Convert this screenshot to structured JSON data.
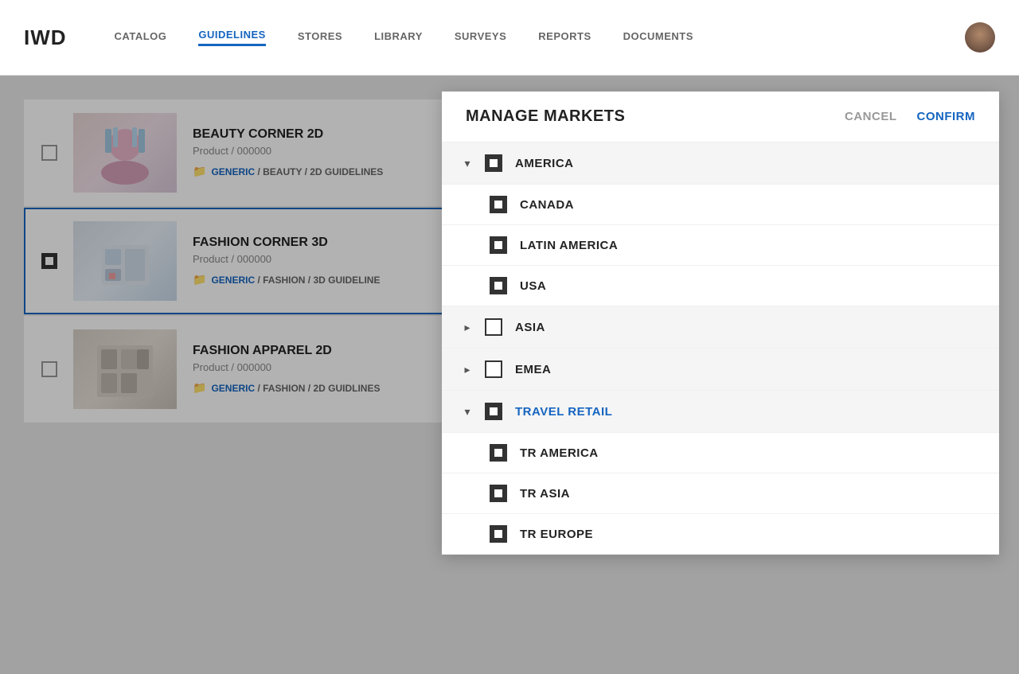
{
  "app": {
    "logo": "IWD",
    "nav": {
      "links": [
        {
          "label": "CATALOG",
          "active": false
        },
        {
          "label": "GUIDELINES",
          "active": true
        },
        {
          "label": "STORES",
          "active": false
        },
        {
          "label": "LIBRARY",
          "active": false
        },
        {
          "label": "SURVEYS",
          "active": false
        },
        {
          "label": "REPORTS",
          "active": false
        },
        {
          "label": "DOCUMENTS",
          "active": false
        }
      ]
    }
  },
  "products": [
    {
      "name": "BEAUTY CORNER 2D",
      "type": "Product",
      "id": "000000",
      "path": "GENERIC / BEAUTY / 2D GUIDELINES",
      "selected": false,
      "checked": false
    },
    {
      "name": "FASHION CORNER 3D",
      "type": "Product",
      "id": "000000",
      "path": "GENERIC / FASHION / 3D GUIDELINE",
      "selected": true,
      "checked": true
    },
    {
      "name": "FASHION APPAREL 2D",
      "type": "Product",
      "id": "000000",
      "path": "GENERIC / FASHION / 2D GUIDLINES",
      "selected": false,
      "checked": false
    }
  ],
  "modal": {
    "title": "MANAGE MARKETS",
    "cancel_label": "CANCEL",
    "confirm_label": "CONFIRM",
    "markets": [
      {
        "id": "america",
        "label": "AMERICA",
        "expanded": true,
        "checked": true,
        "active": false,
        "children": [
          {
            "id": "canada",
            "label": "CANADA",
            "checked": true
          },
          {
            "id": "latin-america",
            "label": "LATIN AMERICA",
            "checked": true
          },
          {
            "id": "usa",
            "label": "USA",
            "checked": true
          }
        ]
      },
      {
        "id": "asia",
        "label": "ASIA",
        "expanded": false,
        "checked": false,
        "active": false,
        "children": []
      },
      {
        "id": "emea",
        "label": "EMEA",
        "expanded": false,
        "checked": false,
        "active": false,
        "children": []
      },
      {
        "id": "travel-retail",
        "label": "TRAVEL RETAIL",
        "expanded": true,
        "checked": true,
        "active": true,
        "children": [
          {
            "id": "tr-america",
            "label": "TR AMERICA",
            "checked": true
          },
          {
            "id": "tr-asia",
            "label": "TR ASIA",
            "checked": true
          },
          {
            "id": "tr-europe",
            "label": "TR EUROPE",
            "checked": true
          }
        ]
      }
    ]
  }
}
